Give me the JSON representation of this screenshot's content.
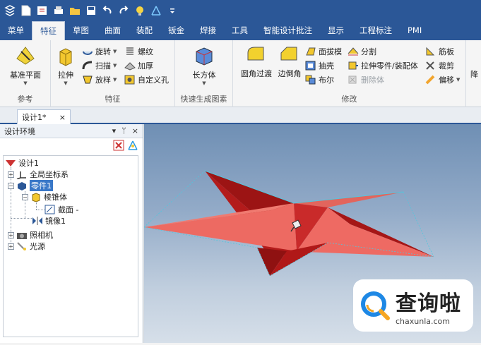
{
  "ribbon_tabs": [
    "菜单",
    "特征",
    "草图",
    "曲面",
    "装配",
    "钣金",
    "焊接",
    "工具",
    "智能设计批注",
    "显示",
    "工程标注",
    "PMI"
  ],
  "active_tab": "特征",
  "groups": {
    "reference": {
      "label": "参考",
      "plane": "基准平面"
    },
    "feature": {
      "label": "特征",
      "extrude": "拉伸",
      "rotate": "旋转",
      "sweep": "扫描",
      "loft": "放样",
      "thread": "螺纹",
      "thicken": "加厚",
      "custom_hole": "自定义孔"
    },
    "quick": {
      "label": "快速生成图素",
      "box": "长方体"
    },
    "modify": {
      "label": "修改",
      "fillet": "圆角过渡",
      "chamfer": "边倒角",
      "draft": "面拔模",
      "shell": "抽壳",
      "boolean": "布尔",
      "split": "分割",
      "stretch": "拉伸零件/装配体",
      "delete_body": "删除体",
      "rib": "筋板",
      "trim": "裁剪",
      "offset": "偏移"
    },
    "more": {
      "label": "降"
    }
  },
  "document_tab": {
    "title": "设计1*",
    "close": "×"
  },
  "panel": {
    "title": "设计环境",
    "controls": [
      "▾",
      "ᛘ",
      "×"
    ],
    "tree": [
      {
        "label": "设计1"
      },
      {
        "label": "全局坐标系"
      },
      {
        "label": "零件1"
      },
      {
        "label": "棱锥体"
      },
      {
        "label": "截面 -"
      },
      {
        "label": "镜像1"
      },
      {
        "label": "照相机"
      },
      {
        "label": "光源"
      }
    ]
  },
  "watermark": {
    "title": "查询啦",
    "url": "chaxunla.com"
  },
  "colors": {
    "brand": "#2b5797",
    "star_dark": "#a01414",
    "star_light": "#e8605a"
  }
}
